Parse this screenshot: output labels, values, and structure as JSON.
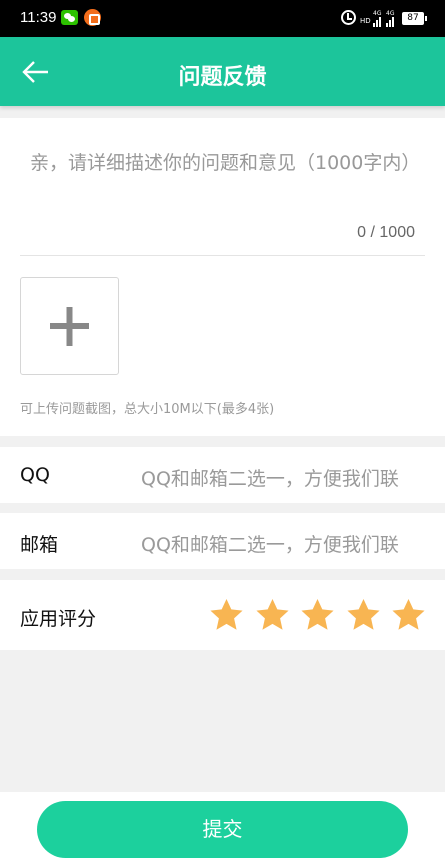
{
  "status_bar": {
    "time": "11:39",
    "network": "4G",
    "hd": "HD",
    "battery": "87",
    "icons": [
      "wechat-icon",
      "app-notification-icon",
      "alarm-icon",
      "signal-icon",
      "battery-icon"
    ]
  },
  "header": {
    "title": "问题反馈",
    "back_icon": "arrow-left-icon"
  },
  "feedback": {
    "placeholder": "亲，请详细描述你的问题和意见（1000字内）",
    "counter": "0 / 1000",
    "upload_icon": "plus-icon",
    "upload_hint": "可上传问题截图，总大小10M以下(最多4张)"
  },
  "contact": {
    "qq_label": "QQ",
    "qq_placeholder": "QQ和邮箱二选一，方便我们联",
    "email_label": "邮箱",
    "email_placeholder": "QQ和邮箱二选一，方便我们联"
  },
  "rating": {
    "label": "应用评分",
    "max": 5,
    "value": 5,
    "star_color": "#f8b552"
  },
  "submit": {
    "label": "提交"
  },
  "colors": {
    "primary": "#1cc59b",
    "submit": "#1cd09d",
    "background": "#f1f1f1"
  }
}
